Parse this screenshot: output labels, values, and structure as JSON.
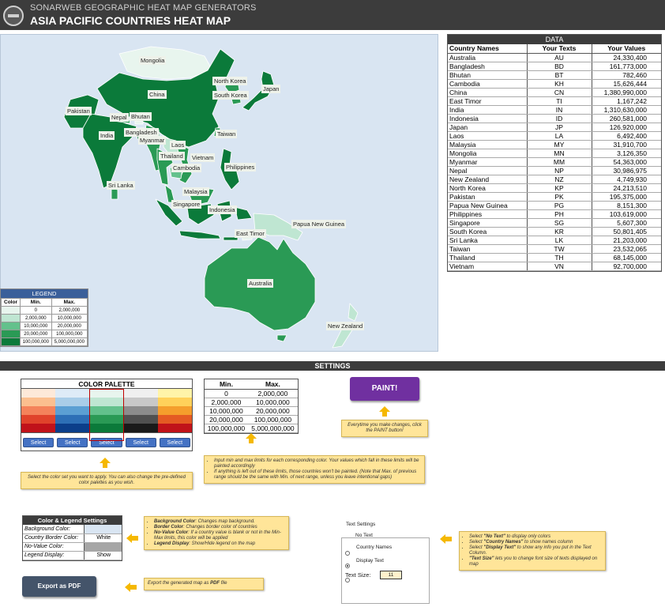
{
  "header": {
    "subtitle": "SONARWEB GEOGRAPHIC HEAT MAP GENERATORS",
    "title": "ASIA PACIFIC COUNTRIES HEAT MAP"
  },
  "colors": {
    "header_bg": "#3c3c3c",
    "map_bg": "#d9e5f2",
    "green_1": "#e8f5ee",
    "green_2": "#bfe6d2",
    "green_3": "#63c18c",
    "green_4": "#2a9a55",
    "green_5": "#0b7a3a",
    "paint_button": "#7030a0",
    "note_bg": "#ffe599"
  },
  "map": {
    "labels": [
      "Mongolia",
      "North Korea",
      "Japan",
      "China",
      "South Korea",
      "Pakistan",
      "Nepal",
      "Bhutan",
      "Bangladesh",
      "India",
      "Myanmar",
      "Laos",
      "Taiwan",
      "Thailand",
      "Vietnam",
      "Cambodia",
      "Philippines",
      "Sri Lanka",
      "Malaysia",
      "Singapore",
      "Indonesia",
      "Papua New Guinea",
      "East Timor",
      "Australia",
      "New Zealand"
    ]
  },
  "legend": {
    "title": "LEGEND",
    "headers": [
      "Color",
      "Min.",
      "Max."
    ],
    "rows": [
      {
        "min": "0",
        "max": "2,000,000"
      },
      {
        "min": "2,000,000",
        "max": "10,000,000"
      },
      {
        "min": "10,000,000",
        "max": "20,000,000"
      },
      {
        "min": "20,000,000",
        "max": "100,000,000"
      },
      {
        "min": "100,000,000",
        "max": "5,000,000,000"
      }
    ]
  },
  "data_table": {
    "title": "DATA",
    "headers": [
      "Country Names",
      "Your Texts",
      "Your Values"
    ],
    "rows": [
      [
        "Australia",
        "AU",
        "24,330,400"
      ],
      [
        "Bangladesh",
        "BD",
        "161,773,000"
      ],
      [
        "Bhutan",
        "BT",
        "782,460"
      ],
      [
        "Cambodia",
        "KH",
        "15,626,444"
      ],
      [
        "China",
        "CN",
        "1,380,990,000"
      ],
      [
        "East Timor",
        "TI",
        "1,167,242"
      ],
      [
        "India",
        "IN",
        "1,310,630,000"
      ],
      [
        "Indonesia",
        "ID",
        "260,581,000"
      ],
      [
        "Japan",
        "JP",
        "126,920,000"
      ],
      [
        "Laos",
        "LA",
        "6,492,400"
      ],
      [
        "Malaysia",
        "MY",
        "31,910,700"
      ],
      [
        "Mongolia",
        "MN",
        "3,126,350"
      ],
      [
        "Myanmar",
        "MM",
        "54,363,000"
      ],
      [
        "Nepal",
        "NP",
        "30,986,975"
      ],
      [
        "New Zealand",
        "NZ",
        "4,749,930"
      ],
      [
        "North Korea",
        "KP",
        "24,213,510"
      ],
      [
        "Pakistan",
        "PK",
        "195,375,000"
      ],
      [
        "Papua New Guinea",
        "PG",
        "8,151,300"
      ],
      [
        "Philippines",
        "PH",
        "103,619,000"
      ],
      [
        "Singapore",
        "SG",
        "5,607,300"
      ],
      [
        "South Korea",
        "KR",
        "50,801,405"
      ],
      [
        "Sri Lanka",
        "LK",
        "21,203,000"
      ],
      [
        "Taiwan",
        "TW",
        "23,532,065"
      ],
      [
        "Thailand",
        "TH",
        "68,145,000"
      ],
      [
        "Vietnam",
        "VN",
        "92,700,000"
      ]
    ]
  },
  "settings": {
    "title": "SETTINGS",
    "palette_title": "COLOR PALETTE",
    "select_label": "Select",
    "palette_columns": [
      [
        "#fde9d9",
        "#fbbf8f",
        "#f4835b",
        "#e0432b",
        "#c0121a"
      ],
      [
        "#deebf7",
        "#a9cde8",
        "#5b9fd3",
        "#2d6fb6",
        "#0b3e8a"
      ],
      [
        "#e8f5ee",
        "#bfe6d2",
        "#63c18c",
        "#2a9a55",
        "#0b7a3a"
      ],
      [
        "#f0f0f0",
        "#c8c8c8",
        "#8c8c8c",
        "#505050",
        "#1a1a1a"
      ],
      [
        "#fff4a8",
        "#ffd15a",
        "#f59e2c",
        "#e45a23",
        "#c0121a"
      ]
    ],
    "minmax_headers": [
      "Min.",
      "Max."
    ],
    "minmax_rows": [
      [
        "0",
        "2,000,000"
      ],
      [
        "2,000,000",
        "10,000,000"
      ],
      [
        "10,000,000",
        "20,000,000"
      ],
      [
        "20,000,000",
        "100,000,000"
      ],
      [
        "100,000,000",
        "5,000,000,000"
      ]
    ],
    "paint_label": "PAINT!",
    "paint_note": "Everytime you make changes, click the PAINT button!",
    "palette_note": "Select the color set you want to apply. You can also change the pre-defined color palettes as you wish.",
    "limits_note_1": "Input min and max limits for each corresponding color. Your values which fall in these limits will be painted accordingly",
    "limits_note_2": "If anything is left out of these limits, those countries won't be painted. (Note that Max. of previous range should be the same with Min. of next range, unless you leave intentional gaps)",
    "cls_title": "Color & Legend Settings",
    "cls_rows": [
      {
        "label": "Background Color:",
        "value": ""
      },
      {
        "label": "Country Border Color:",
        "value": "White"
      },
      {
        "label": "No-Value Color:",
        "value": ""
      },
      {
        "label": "Legend Display:",
        "value": "Show"
      }
    ],
    "cls_note": [
      {
        "bold": "Background Color",
        "rest": ": Changes map background."
      },
      {
        "bold": "Border Color",
        "rest": ": Changes border color of countries"
      },
      {
        "bold": "No-Value Color",
        "rest": ": If a country value is blank or not in the Min-Max limits, this color will be applied"
      },
      {
        "bold": "Legend Display",
        "rest": ": Show/Hide legend on the map"
      }
    ],
    "export_label": "Export as PDF",
    "export_note_pre": "Export the generated map as ",
    "export_note_bold": "PDF",
    "export_note_post": " file",
    "text_settings": {
      "title": "Text Settings",
      "options": [
        "No Text",
        "Country Names",
        "Display Text"
      ],
      "selected": "Display Text",
      "size_label": "Text Size:",
      "size_value": "11"
    },
    "text_note": [
      {
        "pre": "Select ",
        "bold": "\"No Text\"",
        "rest": " to display only colors"
      },
      {
        "pre": "Select ",
        "bold": "\"Country Names\"",
        "rest": " to show names column"
      },
      {
        "pre": "Select ",
        "bold": "\"Display Text\"",
        "rest": " to show any info you put in the Text Column."
      },
      {
        "pre": "",
        "bold": "\"Text Size\"",
        "rest": " lets you to change font size of texts displayed on map"
      }
    ]
  }
}
